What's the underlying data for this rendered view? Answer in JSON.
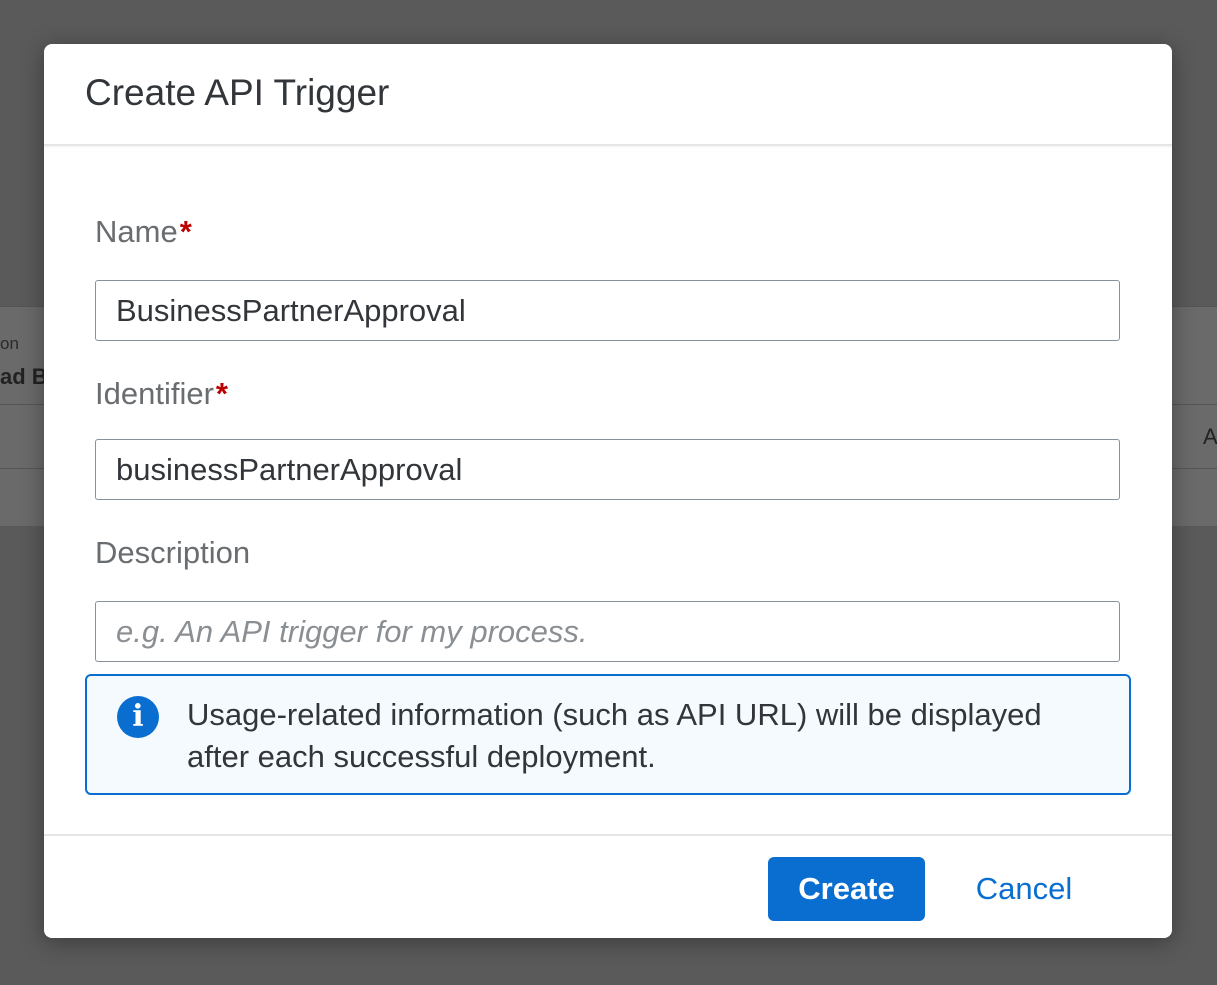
{
  "background": {
    "partial_label": "on",
    "partial_bold": "ad B",
    "partial_right": "A"
  },
  "dialog": {
    "title": "Create API Trigger",
    "required_marker": "*",
    "fields": {
      "name": {
        "label": "Name",
        "value": "BusinessPartnerApproval",
        "required": true
      },
      "identifier": {
        "label": "Identifier",
        "value": "businessPartnerApproval",
        "required": true
      },
      "description": {
        "label": "Description",
        "value": "",
        "placeholder": "e.g. An API trigger for my process."
      }
    },
    "info": {
      "icon": "info-icon",
      "glyph": "i",
      "text": "Usage-related information (such as API URL) will be displayed after each successful deployment."
    },
    "footer": {
      "create_label": "Create",
      "cancel_label": "Cancel"
    }
  },
  "colors": {
    "accent": "#0a6ed1",
    "required": "#bb0000"
  }
}
